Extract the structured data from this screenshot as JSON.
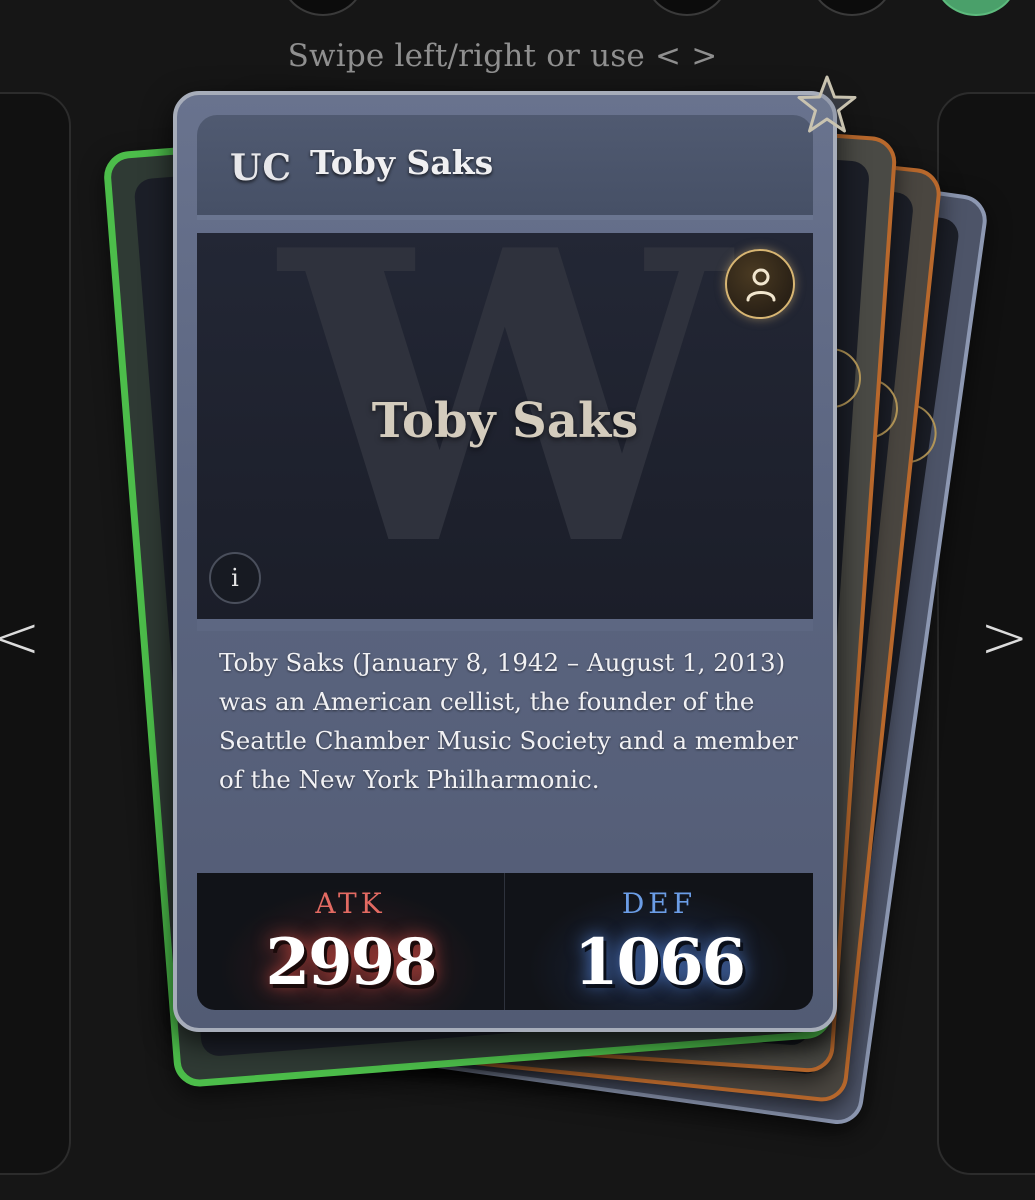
{
  "hint": "Swipe left/right or use < >",
  "nav": {
    "prev": "<",
    "next": ">"
  },
  "card": {
    "rarity": "UC",
    "name": "Toby Saks",
    "watermark_letter": "W",
    "art_title": "Toby Saks",
    "info_label": "i",
    "description": "Toby Saks (January 8, 1942 – August 1, 2013) was an American cellist, the founder of the Seattle Chamber Music Society and a member of the New York Philharmonic.",
    "stats": {
      "atk_label": "ATK",
      "atk_value": "2998",
      "def_label": "DEF",
      "def_value": "1066"
    },
    "type_icon": "person-icon",
    "favorite_icon": "star-outline-icon"
  },
  "colors": {
    "background": "#161616",
    "atk": "#e36a62",
    "def": "#6b9de6",
    "back_card_green": "#4cbd4a",
    "back_card_orange": "#b8682c",
    "badge_gold": "#d8b673"
  }
}
